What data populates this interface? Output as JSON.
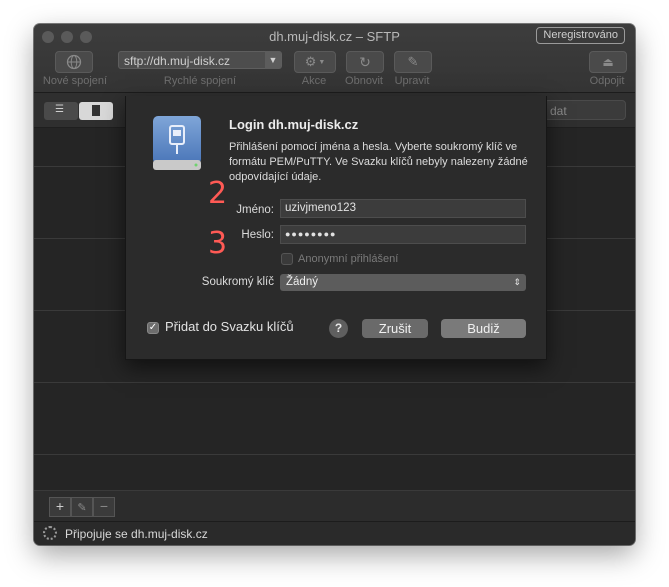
{
  "window": {
    "title": "dh.muj-disk.cz – SFTP",
    "badge": "Neregistrováno"
  },
  "toolbar": {
    "new_connection": "Nové spojení",
    "quick_connect": "Rychlé spojení",
    "quick_connect_value": "sftp://dh.muj-disk.cz",
    "action": "Akce",
    "refresh": "Obnovit",
    "edit": "Upravit",
    "disconnect": "Odpojit"
  },
  "search": {
    "placeholder": "dat"
  },
  "status": {
    "text": "Připojuje se dh.muj-disk.cz"
  },
  "bottom_buttons": {
    "add": "+",
    "remove": "−"
  },
  "dialog": {
    "title": "Login dh.muj-disk.cz",
    "message": "Přihlášení pomocí jména a hesla. Vyberte soukromý klíč ve formátu PEM/PuTTY. Ve Svazku klíčů nebyly nalezeny žádné odpovídající údaje.",
    "username_label": "Jméno:",
    "username_value": "uzivjmeno123",
    "password_label": "Heslo:",
    "password_value": "●●●●●●●●",
    "anonymous_label": "Anonymní přihlášení",
    "private_key_label": "Soukromý klíč",
    "private_key_value": "Žádný",
    "keychain_label": "Přidat do Svazku klíčů",
    "help": "?",
    "cancel": "Zrušit",
    "ok": "Budiž"
  },
  "annotations": {
    "a2": "2",
    "a3": "3"
  }
}
